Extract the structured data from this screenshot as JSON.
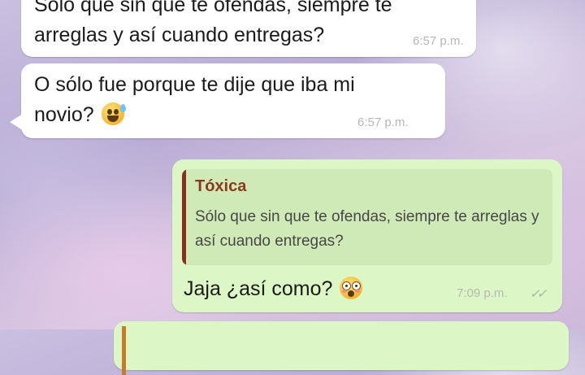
{
  "messages": [
    {
      "direction": "incoming",
      "text": "Sólo que sin que te ofendas, siempre te",
      "text2": "arreglas y así cuando entregas?",
      "time": "6:57 p.m."
    },
    {
      "direction": "incoming",
      "text": "O sólo fue porque te dije que iba mi",
      "text2": "novio?",
      "emoji": "sweat-smile-emoji",
      "time": "6:57 p.m."
    },
    {
      "direction": "outgoing",
      "quote": {
        "author": "Tóxica",
        "text": "Sólo que sin que te ofendas, siempre te arreglas y así cuando entregas?"
      },
      "text": "Jaja ¿así como?",
      "emoji": "flushed-emoji",
      "time": "7:09 p.m.",
      "status_icon": "double-check-icon"
    }
  ],
  "colors": {
    "incoming_bubble": "#ffffff",
    "outgoing_bubble": "#dcf7c5",
    "quote_bar": "#8b2e1f",
    "quote_author": "#8a3a22"
  }
}
